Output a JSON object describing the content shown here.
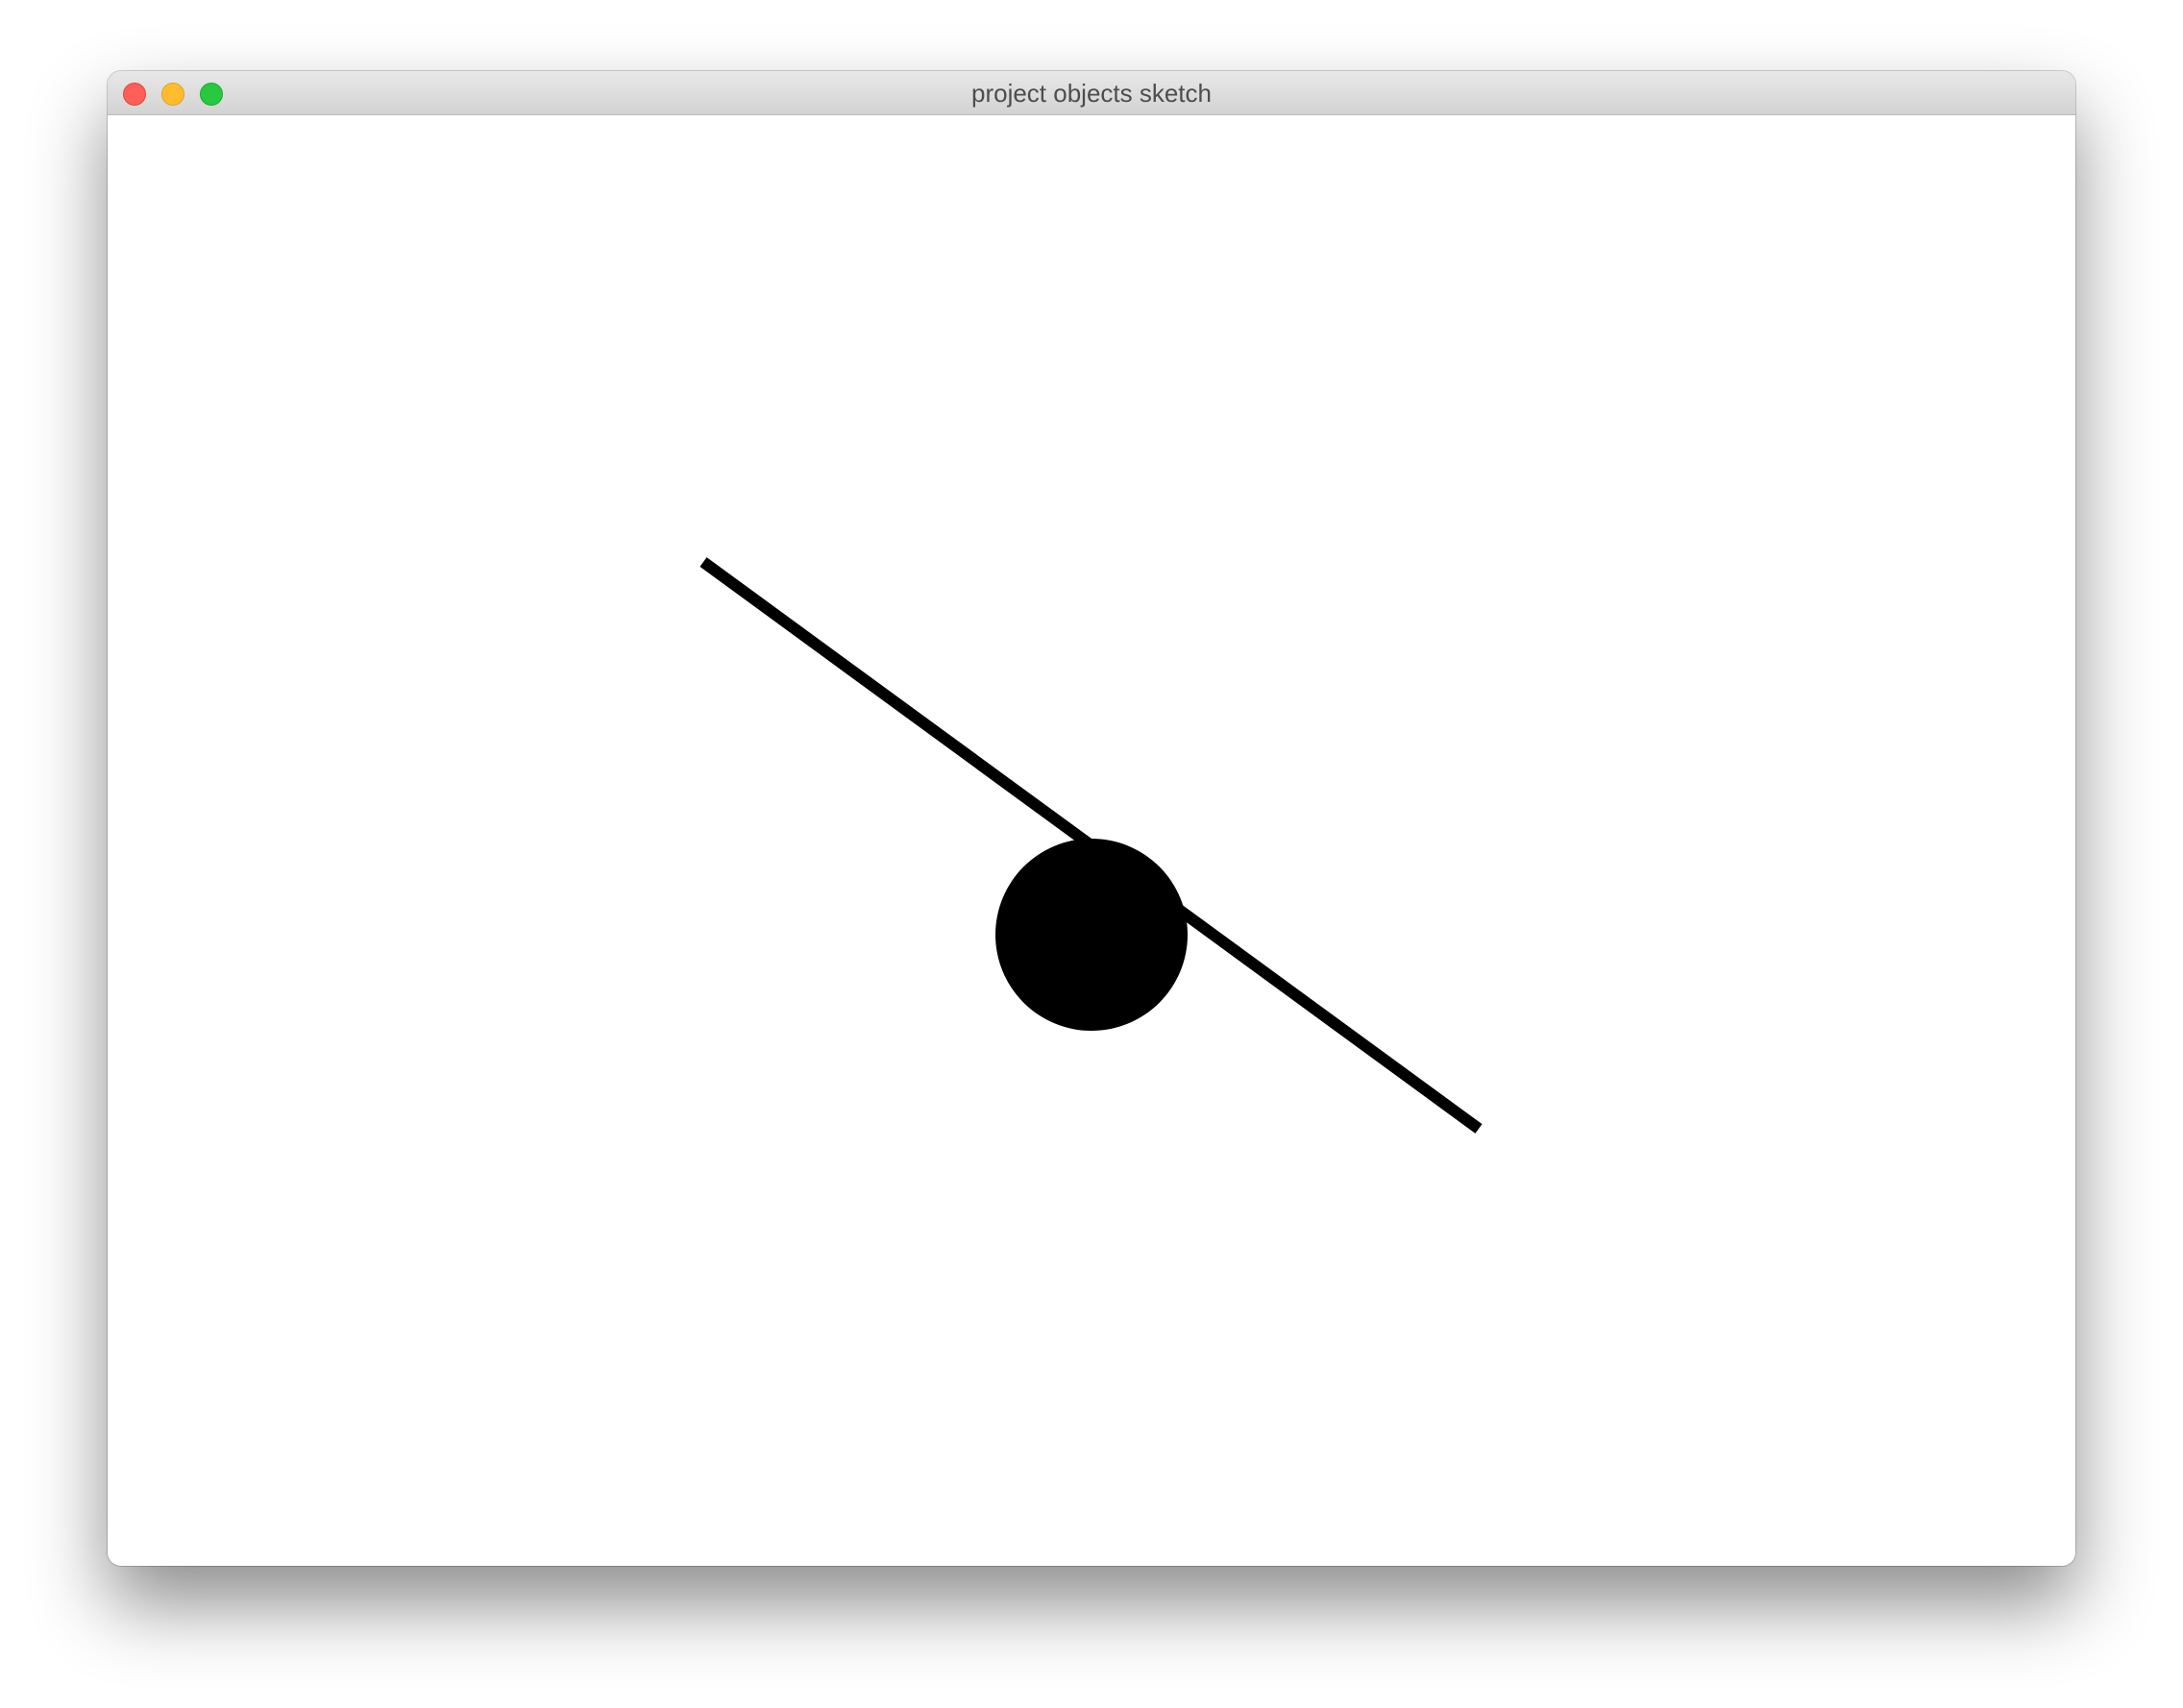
{
  "window": {
    "title": "project objects sketch"
  },
  "titlebar": {
    "buttons": [
      {
        "name": "close",
        "color": "#fe5f57"
      },
      {
        "name": "minimize",
        "color": "#febc2e"
      },
      {
        "name": "maximize",
        "color": "#28c840"
      }
    ]
  },
  "sketch": {
    "background_color": "#ffffff",
    "stroke_color": "#000000",
    "fill_color": "#000000",
    "shapes": [
      "line",
      "circle"
    ]
  }
}
